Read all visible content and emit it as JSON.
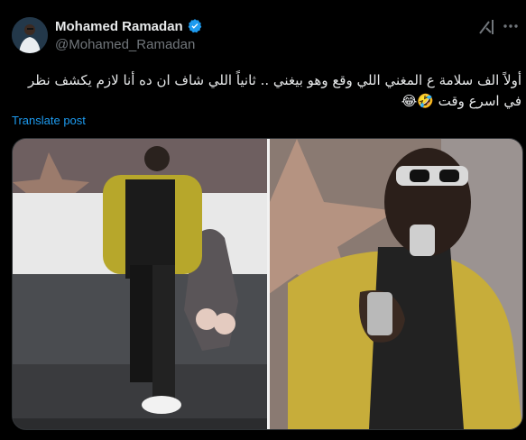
{
  "author": {
    "display_name": "Mohamed Ramadan",
    "handle": "@Mohamed_Ramadan",
    "verified": true,
    "avatar_icon": "avatar-photo"
  },
  "header_actions": {
    "grok_icon": "grok-icon",
    "more_icon": "more-options-icon"
  },
  "tweet": {
    "text": "أولاً الف سلامة ع المغني اللي وقع وهو بيغني .. ثانياً اللي شاف ان ده أنا لازم يكشف نظر في اسرع وقت 🤣😂",
    "translate_label": "Translate post"
  },
  "media": {
    "panels": [
      "video-frame-full-body",
      "video-frame-closeup"
    ]
  },
  "colors": {
    "background": "#000000",
    "text_primary": "#e7e9ea",
    "text_secondary": "#71767b",
    "accent": "#1d9bf0",
    "verified": "#1d9bf0"
  }
}
